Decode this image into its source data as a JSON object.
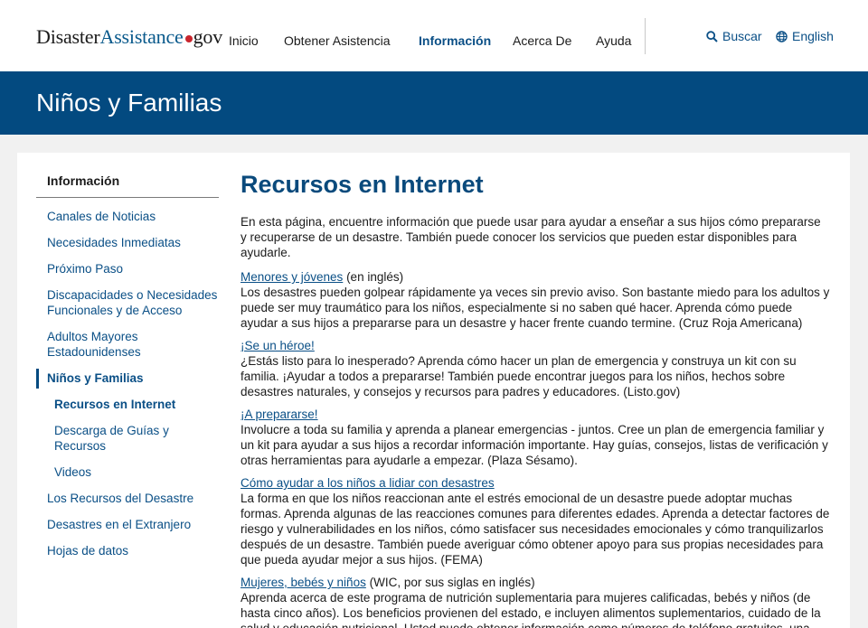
{
  "logo": {
    "part1": "Disaster",
    "part2": "Assistance",
    "part3": "gov"
  },
  "nav": {
    "items": [
      "Inicio",
      "Obtener Asistencia",
      "Información",
      "Acerca De",
      "Ayuda"
    ],
    "active": "Información"
  },
  "utility": {
    "search": "Buscar",
    "language": "English"
  },
  "banner": {
    "title": "Niños y Familias"
  },
  "sidebar": {
    "title": "Información",
    "items": [
      "Canales de Noticias",
      "Necesidades Inmediatas",
      "Próximo Paso",
      "Discapacidades o Necesidades Funcionales y de Acceso",
      "Adultos Mayores Estadounidenses",
      "Niños y Familias",
      "Recursos en Internet",
      "Descarga de Guías y Recursos",
      "Videos",
      "Los Recursos del Desastre",
      "Desastres en el Extranjero",
      "Hojas de datos"
    ]
  },
  "main": {
    "heading": "Recursos en Internet",
    "intro": "En esta página, encuentre información que puede usar para ayudar a enseñar a sus hijos cómo prepararse y recuperarse de un desastre. También puede conocer los servicios que pueden estar disponibles para ayudarle.",
    "resources": [
      {
        "link": "Menores y jóvenes",
        "note": " (en inglés)",
        "desc": "Los desastres pueden golpear rápidamente ya veces sin previo aviso. Son bastante miedo para los adultos y puede ser muy traumático para los niños, especialmente si no saben qué hacer. Aprenda cómo puede ayudar a sus hijos a prepararse para un desastre y hacer frente cuando termine. (Cruz Roja Americana)"
      },
      {
        "link": "¡Se un héroe!",
        "note": "",
        "desc": "¿Estás listo para lo inesperado? Aprenda cómo hacer un plan de emergencia y construya un kit con su familia. ¡Ayudar a todos a prepararse! También puede encontrar juegos para los niños, hechos sobre desastres naturales, y consejos y recursos para padres y educadores. (Listo.gov)"
      },
      {
        "link": "¡A prepararse!",
        "note": "",
        "desc": "Involucre a toda su familia y aprenda a planear emergencias - juntos. Cree un plan de emergencia familiar y un kit para ayudar a sus hijos a recordar información importante. Hay guías, consejos, listas de verificación y otras herramientas para ayudarle a empezar. (Plaza Sésamo)."
      },
      {
        "link": "Cómo ayudar a los niños a lidiar con desastres",
        "note": "",
        "desc": "La forma en que los niños reaccionan ante el estrés emocional de un desastre puede adoptar muchas formas. Aprenda algunas de las reacciones comunes para diferentes edades. Aprenda a detectar factores de riesgo y vulnerabilidades en los niños, cómo satisfacer sus necesidades emocionales y cómo tranquilizarlos después de un desastre. También puede averiguar cómo obtener apoyo para sus propias necesidades para que pueda ayudar mejor a sus hijos. (FEMA)"
      },
      {
        "link": "Mujeres, bebés y niños",
        "note": " (WIC, por sus siglas en inglés)",
        "desc": "Aprenda acerca de este programa de nutrición suplementaria para mujeres calificadas, bebés y niños (de hasta cinco años). Los beneficios provienen del estado, e incluyen alimentos suplementarios, cuidado de la salud y educación nutricional. Usted puede obtener información como números de teléfono gratuitos, una"
      }
    ]
  },
  "colors": {
    "banner": "#034a80",
    "link": "#0a4f86",
    "heading": "#0a4a7c",
    "logo_dot": "#c9252d"
  }
}
